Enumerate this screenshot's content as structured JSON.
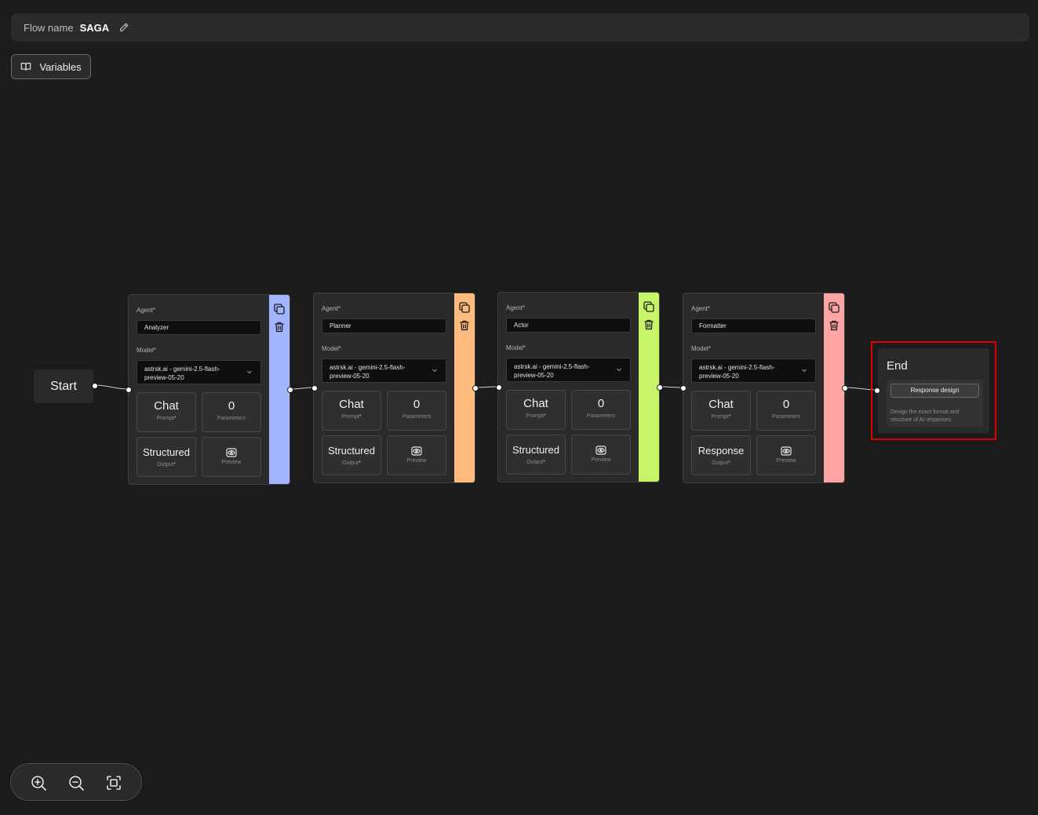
{
  "flow": {
    "label": "Flow name",
    "name": "SAGA"
  },
  "toolbar": {
    "variables_label": "Variables"
  },
  "nodes": {
    "start": {
      "label": "Start"
    },
    "agents": [
      {
        "agent_label": "Agent",
        "required_mark": "*",
        "name": "Analyzer",
        "model_label": "Model",
        "model": "astrsk.ai - gemini-2.5-flash-preview-05-20",
        "accent": "#a3b4ff",
        "prompt_title": "Chat",
        "prompt_sub": "Prompt",
        "params_count": "0",
        "params_sub": "Parameters",
        "output_title": "Structured",
        "output_sub": "Output",
        "preview_sub": "Preview"
      },
      {
        "agent_label": "Agent",
        "required_mark": "*",
        "name": "Planner",
        "model_label": "Model",
        "model": "astrsk.ai - gemini-2.5-flash-preview-05-20",
        "accent": "#fdbb7d",
        "prompt_title": "Chat",
        "prompt_sub": "Prompt",
        "params_count": "0",
        "params_sub": "Parameters",
        "output_title": "Structured",
        "output_sub": "Output",
        "preview_sub": "Preview"
      },
      {
        "agent_label": "Agent",
        "required_mark": "*",
        "name": "Actor",
        "model_label": "Model",
        "model": "astrsk.ai - gemini-2.5-flash-preview-05-20",
        "accent": "#c8f46a",
        "prompt_title": "Chat",
        "prompt_sub": "Prompt",
        "params_count": "0",
        "params_sub": "Parameters",
        "output_title": "Structured",
        "output_sub": "Output",
        "preview_sub": "Preview"
      },
      {
        "agent_label": "Agent",
        "required_mark": "*",
        "name": "Formatter",
        "model_label": "Model",
        "model": "astrsk.ai - gemini-2.5-flash-preview-05-20",
        "accent": "#fda5a5",
        "prompt_title": "Chat",
        "prompt_sub": "Prompt",
        "params_count": "0",
        "params_sub": "Parameters",
        "output_title": "Response",
        "output_sub": "Output",
        "preview_sub": "Preview"
      }
    ],
    "end": {
      "label": "End",
      "button_label": "Response design",
      "description": "Design the exact format and structure of AI responses",
      "highlight_color": "#e00000"
    }
  },
  "zoom_controls": {
    "icons": [
      "zoom-in-icon",
      "zoom-out-icon",
      "fit-view-icon"
    ]
  }
}
